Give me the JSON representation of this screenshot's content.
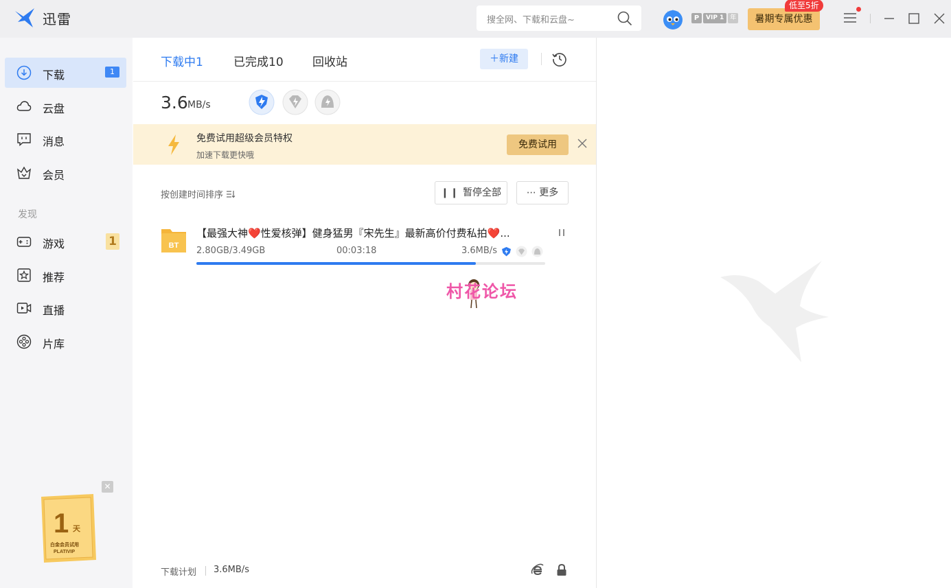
{
  "app": {
    "name": "迅雷",
    "brand_color": "#2e7bf0",
    "accent": "#f4c271"
  },
  "header": {
    "search_placeholder": "搜全网、下载和云盘~",
    "vip": {
      "p": "P",
      "level": "VIP 1",
      "year": "年"
    },
    "promo": {
      "label": "暑期专属优惠",
      "tag": "低至5折"
    }
  },
  "sidebar": {
    "items": [
      {
        "label": "下载",
        "badge": "1",
        "icon": "download-icon"
      },
      {
        "label": "云盘",
        "icon": "cloud-icon"
      },
      {
        "label": "消息",
        "icon": "message-icon"
      },
      {
        "label": "会员",
        "icon": "crown-icon"
      }
    ],
    "section": "发现",
    "discover": [
      {
        "label": "游戏",
        "badge": "1",
        "icon": "gamepad-icon"
      },
      {
        "label": "推荐",
        "icon": "star-icon"
      },
      {
        "label": "直播",
        "icon": "live-icon"
      },
      {
        "label": "片库",
        "icon": "film-icon"
      }
    ],
    "trial_card": {
      "number": "1",
      "unit": "天",
      "line1": "白金会员试用",
      "line2": "PLATIVIP"
    }
  },
  "main": {
    "tabs": [
      {
        "label": "下载中1"
      },
      {
        "label": "已完成10"
      },
      {
        "label": "回收站"
      }
    ],
    "new_button": "新建",
    "speed": {
      "value": "3.6",
      "unit": "MB/s"
    },
    "banner": {
      "title": "免费试用超级会员特权",
      "subtitle": "加速下载更快哦",
      "button": "免费试用"
    },
    "sort_label": "按创建时间排序",
    "pause_all": "暂停全部",
    "more": "更多",
    "task": {
      "name": "【最强大神❤️性爱核弹】健身猛男『宋先生』最新高价付费私拍❤️...",
      "size": "2.80GB/3.49GB",
      "time": "00:03:18",
      "speed": "3.6MB/s",
      "progress": 0.802,
      "type_label": "BT"
    },
    "watermark": "村花论坛",
    "footer": {
      "plan": "下载计划",
      "speed": "3.6MB/s"
    }
  }
}
